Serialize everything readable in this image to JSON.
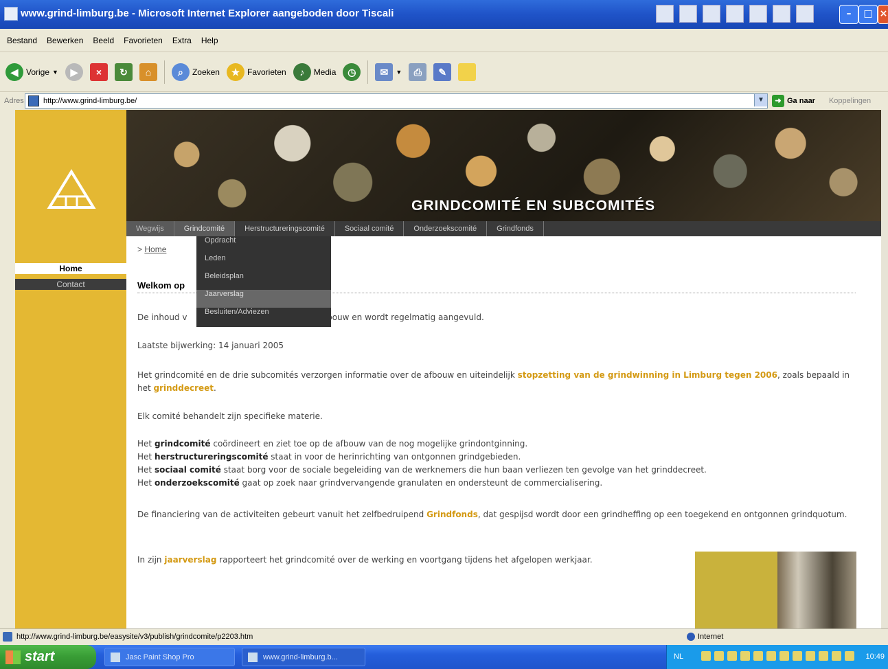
{
  "window": {
    "title": "www.grind-limburg.be - Microsoft Internet Explorer aangeboden door Tiscali"
  },
  "menu": [
    "Bestand",
    "Bewerken",
    "Beeld",
    "Favorieten",
    "Extra",
    "Help"
  ],
  "toolbar": {
    "back": "Vorige",
    "search": "Zoeken",
    "favorites": "Favorieten",
    "media": "Media"
  },
  "address": {
    "label": "Adres",
    "url": "http://www.grind-limburg.be/",
    "go": "Ga naar",
    "links": "Koppelingen"
  },
  "site": {
    "banner_title": "GRINDCOMITÉ EN SUBCOMITÉS",
    "sidebar": {
      "home": "Home",
      "contact": "Contact"
    },
    "topnav": [
      "Wegwijs",
      "Grindcomité",
      "Herstructureringscomité",
      "Sociaal comité",
      "Onderzoekscomité",
      "Grindfonds"
    ],
    "dropdown": [
      "Opdracht",
      "Leden",
      "Beleidsplan",
      "Jaarverslag",
      "Besluiten/Adviezen"
    ],
    "breadcrumb_prefix": ">",
    "breadcrumb": "Home",
    "welcome": "Welkom op",
    "intro_pre": "De inhoud v",
    "intro_post": "pbouw en wordt regelmatig aangevuld.",
    "updated": "Laatste bijwerking: 14 januari 2005",
    "p1_a": "Het grindcomité en de drie subcomités verzorgen informatie over de afbouw en uiteindelijk ",
    "p1_hl": "stopzetting van de grindwinning in Limburg tegen 2006",
    "p1_b": ", zoals bepaald in het ",
    "p1_hl2": "grinddecreet",
    "p1_c": ".",
    "p2": "Elk comité behandelt zijn specifieke materie.",
    "l1_pre": "Het ",
    "l1_b": "grindcomité",
    "l1_post": " coördineert en ziet toe op de afbouw van de nog mogelijke grindontginning.",
    "l2_pre": "Het ",
    "l2_b": "herstructureringscomité",
    "l2_post": " staat in voor de herinrichting van ontgonnen grindgebieden.",
    "l3_pre": "Het ",
    "l3_b": "sociaal comité",
    "l3_post": " staat borg voor de sociale begeleiding van de werknemers die hun baan verliezen ten gevolge van het grinddecreet.",
    "l4_pre": "Het ",
    "l4_b": "onderzoekscomité",
    "l4_post": " gaat op zoek naar grindvervangende granulaten en ondersteunt de commercialisering.",
    "p3_a": "De financiering van de activiteiten gebeurt vanuit het zelfbedruipend ",
    "p3_hl": "Grindfonds",
    "p3_b": ", dat gespijsd wordt door een grindheffing op een toegekend en ontgonnen grindquotum.",
    "p4_a": "In zijn ",
    "p4_hl": "jaarverslag",
    "p4_b": " rapporteert het grindcomité over de werking en voortgang tijdens het afgelopen werkjaar."
  },
  "status": {
    "url": "http://www.grind-limburg.be/easysite/v3/publish/grindcomite/p2203.htm",
    "zone": "Internet"
  },
  "taskbar": {
    "start": "start",
    "items": [
      "Jasc Paint Shop Pro",
      "www.grind-limburg.b..."
    ],
    "lang": "NL",
    "clock": "10:49"
  }
}
